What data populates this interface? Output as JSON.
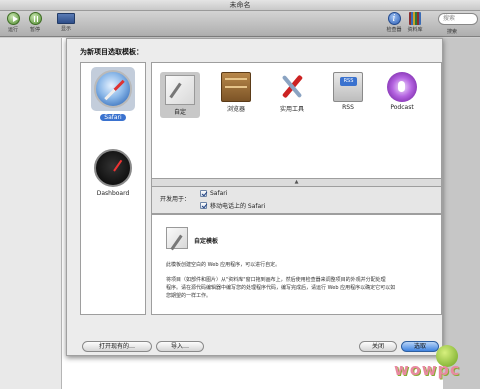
{
  "window": {
    "title": "未命名"
  },
  "toolbar": {
    "run_label": "运行",
    "pause_label": "暂停",
    "display_label": "显示",
    "inspector_label": "检查器",
    "library_label": "资料库",
    "search_placeholder": "搜索",
    "search_caption": "搜索"
  },
  "sheet": {
    "heading": "为新项目选取模板：",
    "categories": [
      {
        "label": "Safari",
        "icon": "safari-compass-icon",
        "selected": true
      },
      {
        "label": "Dashboard",
        "icon": "dashboard-gauge-icon",
        "selected": false
      }
    ],
    "templates": [
      {
        "label": "自定",
        "icon": "custom-template-icon",
        "selected": true
      },
      {
        "label": "浏览器",
        "icon": "browser-template-icon",
        "selected": false
      },
      {
        "label": "实用工具",
        "icon": "utility-tools-icon",
        "selected": false
      },
      {
        "label": "RSS",
        "icon": "rss-icon",
        "selected": false
      },
      {
        "label": "Podcast",
        "icon": "podcast-icon",
        "selected": false
      }
    ],
    "develop_for_label": "开发用于：",
    "targets": [
      {
        "label": "Safari",
        "checked": true
      },
      {
        "label": "移动电话上的 Safari",
        "checked": true
      }
    ],
    "description": {
      "title": "自定模板",
      "line1": "此模板创建空白的 Web 应用程序，可以进行自定。",
      "line2": "将项目（如部件和图片）从\"资料库\"窗口拖到画布上，然后使用检查器来调整项目的外观并分配处理",
      "line3": "程序。请在源代码编辑器中编写您的处理程序代码，编写完成后，请运行 Web 应用程序以确定它可以如",
      "line4": "您期望的一样工作。"
    },
    "buttons": {
      "open_existing": "打开现有的…",
      "import": "导入…",
      "close": "关闭",
      "choose": "选取"
    }
  },
  "watermark": "wowpc"
}
